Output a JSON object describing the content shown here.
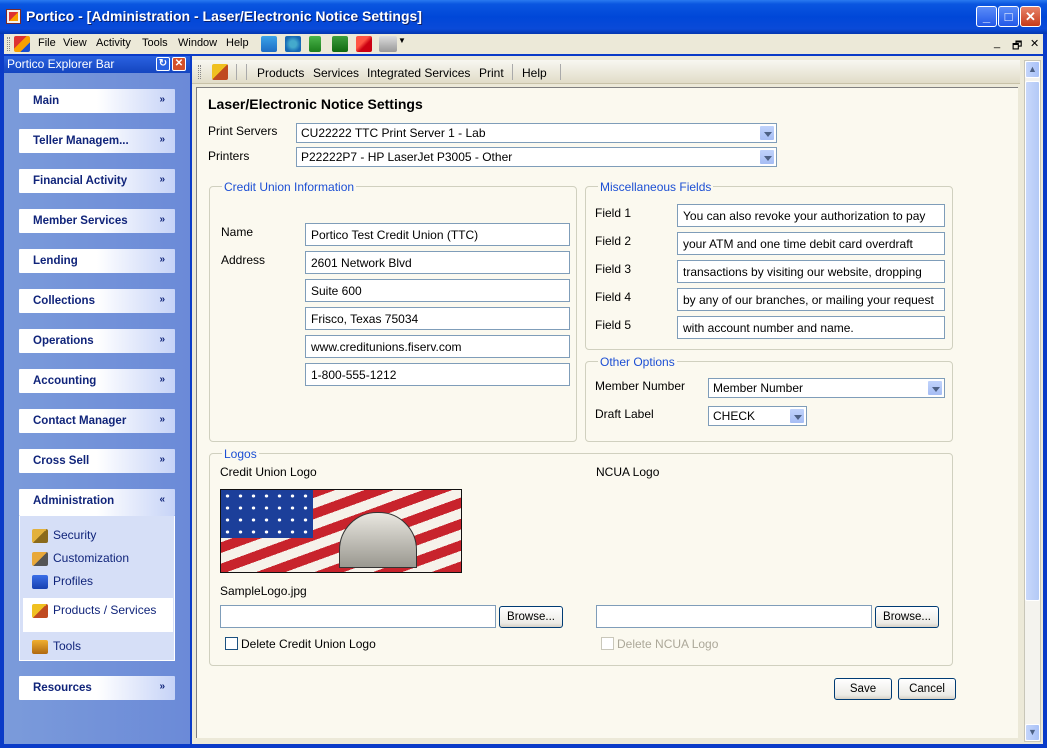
{
  "window": {
    "title": "Portico - [Administration - Laser/Electronic Notice Settings]",
    "controls": {
      "minimize": "_",
      "maximize": "□",
      "close": "✕"
    }
  },
  "menubar": {
    "items": [
      "File",
      "View",
      "Activity",
      "Tools",
      "Window",
      "Help"
    ],
    "mdi_controls": {
      "minimize": "_",
      "restore": "🗗",
      "close": "✕"
    }
  },
  "explorer": {
    "title": "Portico Explorer Bar",
    "groups": [
      {
        "label": "Main",
        "chevron": "»"
      },
      {
        "label": "Teller Managem...",
        "chevron": "»"
      },
      {
        "label": "Financial Activity",
        "chevron": "»"
      },
      {
        "label": "Member Services",
        "chevron": "»"
      },
      {
        "label": "Lending",
        "chevron": "»"
      },
      {
        "label": "Collections",
        "chevron": "»"
      },
      {
        "label": "Operations",
        "chevron": "»"
      },
      {
        "label": "Accounting",
        "chevron": "»"
      },
      {
        "label": "Contact Manager",
        "chevron": "»"
      },
      {
        "label": "Cross Sell",
        "chevron": "»"
      },
      {
        "label": "Administration",
        "chevron": "«"
      },
      {
        "label": "Resources",
        "chevron": "»"
      }
    ],
    "admin_items": [
      {
        "label": "Security",
        "icon": "key-icon"
      },
      {
        "label": "Customization",
        "icon": "tools-icon"
      },
      {
        "label": "Profiles",
        "icon": "profiles-icon"
      },
      {
        "label": "Products / Services",
        "icon": "products-icon"
      },
      {
        "label": "Tools",
        "icon": "toolbox-icon"
      }
    ]
  },
  "tabs": {
    "items": [
      "Products",
      "Services",
      "Integrated Services",
      "Print",
      "Help"
    ]
  },
  "form": {
    "title": "Laser/Electronic Notice Settings",
    "print_servers_label": "Print Servers",
    "print_servers_value": "CU22222 TTC Print Server 1 - Lab",
    "printers_label": "Printers",
    "printers_value": "P22222P7 - HP LaserJet P3005 - Other",
    "cu_info": {
      "legend": "Credit Union Information",
      "name_label": "Name",
      "address_label": "Address",
      "name": "Portico Test Credit Union (TTC)",
      "address_lines": [
        "2601 Network Blvd",
        "Suite 600",
        "Frisco, Texas  75034",
        "www.creditunions.fiserv.com",
        "1-800-555-1212"
      ]
    },
    "misc": {
      "legend": "Miscellaneous Fields",
      "fields": [
        {
          "label": "Field 1",
          "value": "You can also revoke your authorization to pay"
        },
        {
          "label": "Field 2",
          "value": "your ATM and one time debit card overdraft"
        },
        {
          "label": "Field 3",
          "value": "transactions by visiting our website, dropping"
        },
        {
          "label": "Field 4",
          "value": "by any of our branches, or mailing your request"
        },
        {
          "label": "Field 5",
          "value": "with account number and name."
        }
      ]
    },
    "other": {
      "legend": "Other Options",
      "member_number_label": "Member Number",
      "member_number_value": "Member Number",
      "draft_label_label": "Draft Label",
      "draft_label_value": "CHECK"
    },
    "logos": {
      "legend": "Logos",
      "cu_logo_label": "Credit Union Logo",
      "ncua_logo_label": "NCUA Logo",
      "cu_logo_file": "SampleLogo.jpg",
      "cu_path": "",
      "ncua_path": "",
      "browse": "Browse...",
      "delete_cu": "Delete Credit Union Logo",
      "delete_ncua": "Delete NCUA Logo"
    },
    "save": "Save",
    "cancel": "Cancel"
  },
  "colors": {
    "accent": "#0047d8",
    "legend": "#1c4fd4",
    "explorer": "#6b8ad8"
  }
}
